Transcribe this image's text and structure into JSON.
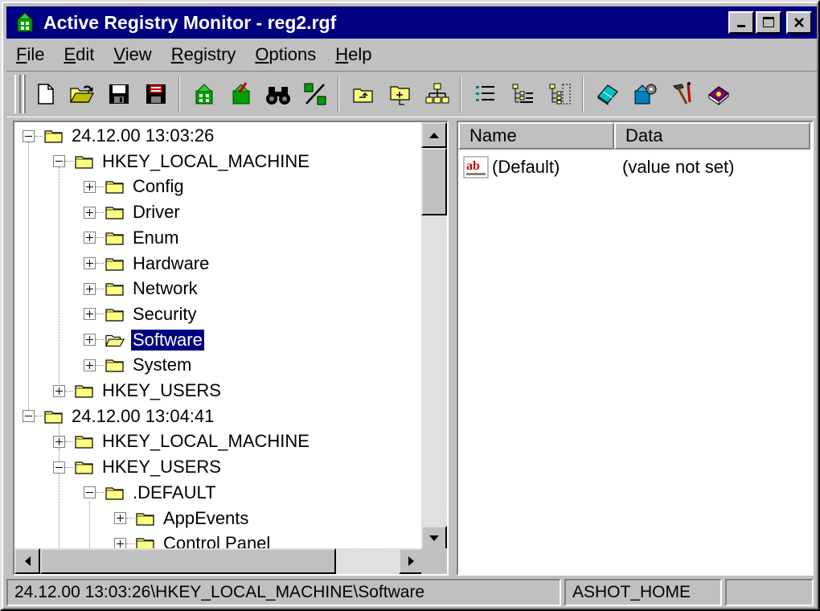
{
  "window": {
    "title": "Active Registry Monitor - reg2.rgf"
  },
  "menu": [
    {
      "label": "File",
      "u": "F",
      "rest": "ile"
    },
    {
      "label": "Edit",
      "u": "E",
      "rest": "dit"
    },
    {
      "label": "View",
      "u": "V",
      "rest": "iew"
    },
    {
      "label": "Registry",
      "u": "R",
      "rest": "egistry"
    },
    {
      "label": "Options",
      "u": "O",
      "rest": "ptions"
    },
    {
      "label": "Help",
      "u": "H",
      "rest": "elp"
    }
  ],
  "tree": {
    "rows": [
      {
        "label": "24.12.00 13:03:26",
        "level": 0,
        "expander": "minus"
      },
      {
        "label": "HKEY_LOCAL_MACHINE",
        "level": 1,
        "expander": "minus"
      },
      {
        "label": "Config",
        "level": 2,
        "expander": "plus"
      },
      {
        "label": "Driver",
        "level": 2,
        "expander": "plus"
      },
      {
        "label": "Enum",
        "level": 2,
        "expander": "plus"
      },
      {
        "label": "Hardware",
        "level": 2,
        "expander": "plus"
      },
      {
        "label": "Network",
        "level": 2,
        "expander": "plus"
      },
      {
        "label": "Security",
        "level": 2,
        "expander": "plus"
      },
      {
        "label": "Software",
        "level": 2,
        "expander": "plus",
        "selected": true
      },
      {
        "label": "System",
        "level": 2,
        "expander": "plus"
      },
      {
        "label": "HKEY_USERS",
        "level": 1,
        "expander": "plus"
      },
      {
        "label": "24.12.00 13:04:41",
        "level": 0,
        "expander": "minus"
      },
      {
        "label": "HKEY_LOCAL_MACHINE",
        "level": 1,
        "expander": "plus"
      },
      {
        "label": "HKEY_USERS",
        "level": 1,
        "expander": "minus"
      },
      {
        "label": ".DEFAULT",
        "level": 2,
        "expander": "minus"
      },
      {
        "label": "AppEvents",
        "level": 3,
        "expander": "plus"
      },
      {
        "label": "Control Panel",
        "level": 3,
        "expander": "plus"
      }
    ]
  },
  "list": {
    "columns": [
      "Name",
      "Data"
    ],
    "rows": [
      {
        "name": "(Default)",
        "data": "(value not set)"
      }
    ]
  },
  "status": {
    "path": "24.12.00 13:03:26\\HKEY_LOCAL_MACHINE\\Software",
    "computer": "ASHOT_HOME"
  },
  "colors": {
    "titlebar": "#000080",
    "face": "#c0c0c0",
    "folder": "#ffff80",
    "selection": "#000080"
  }
}
